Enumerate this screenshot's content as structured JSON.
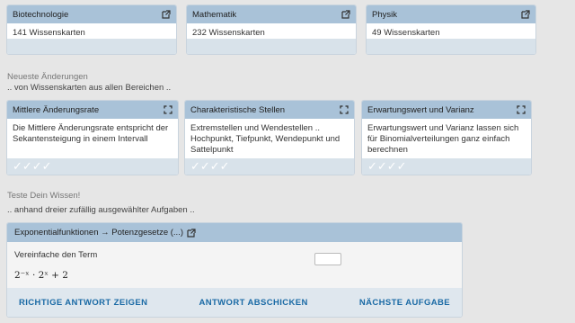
{
  "categories": [
    {
      "title": "Biotechnologie",
      "count": "141 Wissenskarten"
    },
    {
      "title": "Mathematik",
      "count": "232 Wissenskarten"
    },
    {
      "title": "Physik",
      "count": "49 Wissenskarten"
    }
  ],
  "recent": {
    "title": "Neueste Änderungen",
    "subtitle": ".. von Wissenskarten aus allen Bereichen ..",
    "cards": [
      {
        "title": "Mittlere Änderungsrate",
        "text": "Die Mittlere Änderungsrate entspricht der Sekantensteigung in einem Intervall",
        "checks": "✓✓✓✓"
      },
      {
        "title": "Charakteristische Stellen",
        "text": "Extremstellen und Wendestellen .. Hochpunkt, Tiefpunkt, Wendepunkt und Sattelpunkt",
        "checks": "✓✓✓✓"
      },
      {
        "title": "Erwartungswert und Varianz",
        "text": "Erwartungswert und Varianz lassen sich für Binomialverteilungen ganz einfach berechnen",
        "checks": "✓✓✓✓"
      }
    ]
  },
  "quiz_section": {
    "title": "Teste Dein Wissen!",
    "subtitle": ".. anhand dreier zufällig ausgewählter Aufgaben .."
  },
  "quiz": {
    "header": "Exponentialfunktionen → Potenzgesetze (...)",
    "prompt": "Vereinfache den Term",
    "formula": "2⁻ˣ · 2ˣ + 2",
    "answer_value": "",
    "actions": {
      "show_answer": "RICHTIGE ANTWORT ZEIGEN",
      "submit": "ANTWORT ABSCHICKEN",
      "next": "NÄCHSTE AUFGABE"
    }
  },
  "colors": {
    "header": "#a9c2d8",
    "footer": "#d8e2ea",
    "link": "#1a6aa5",
    "background": "#e6e6e6"
  }
}
